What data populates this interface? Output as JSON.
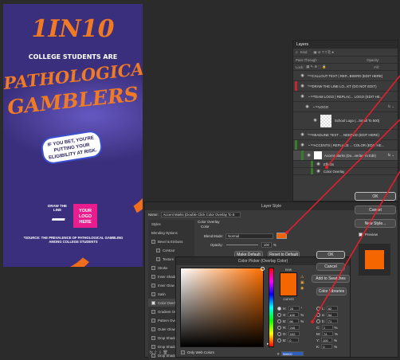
{
  "poster": {
    "headline_1": "1IN10",
    "headline_2": "COLLEGE STUDENTS ARE",
    "headline_3": "PATHOLOGICAL",
    "headline_4": "GAMBLERS",
    "bubble": "IF YOU BET, YOU'RE PUTTING YOUR ELIGIBILITY AT RISK.",
    "draw_line": "DRAW THE LINE",
    "logo_box": "YOUR LOGO HERE",
    "footnote": "*SOURCE: THE PREVALENCE OF PATHOLOGICAL GAMBLING AMONG COLLEGE STUDENTS",
    "colors": {
      "bg": "#3a2f7c",
      "orange": "#f06d1c",
      "pink": "#ea1d8f"
    }
  },
  "layers": {
    "title": "Layers",
    "search_placeholder": "Kind",
    "blend_mode": "Pass Through",
    "opacity_label": "Opacity:",
    "lock_label": "Lock:",
    "fill_label": "Fill:",
    "rows": [
      {
        "label": "CALLOUT TEXT | REP...BSERD (EDIT HERE)",
        "color": "#3b3b3b"
      },
      {
        "label": "DRAW THE LINE LO...KT (DO NOT EDIT)",
        "color": "#c1272d"
      },
      {
        "label": "TEAM LOGO | REPLAC... LOGO (EDIT HE...",
        "color": "#3b3b3b"
      },
      {
        "label": "LOGO",
        "color": "#3b3b3b"
      },
      {
        "label": "School Logo (...Small To 500)",
        "color": "#3b3b3b"
      },
      {
        "label": "HEADLINE TEXT ... NEEDED (EDIT HERE)",
        "color": "#3b3b3b"
      },
      {
        "label": "ACCENTS | REPLACE ... COLOR (EDIT HE...",
        "color": "#3b7a2a"
      },
      {
        "label": "Accent Marks (Do...verlay To Edit)",
        "color": "#3b7a2a"
      },
      {
        "label": "Effects",
        "color": "#3b7a2a"
      },
      {
        "label": "Color Overlay",
        "color": "#3b7a2a"
      }
    ]
  },
  "layer_style": {
    "title": "Layer Style",
    "name_label": "Name:",
    "name_value": "Accent Marks (Double Click Color Overlay To E",
    "sidebar": [
      "Styles",
      "Blending Options",
      "Bevel & Emboss",
      "Contour",
      "Texture",
      "Stroke",
      "Inner Shadow",
      "Inner Glow",
      "Satin",
      "Color Overlay",
      "Gradient Overlay",
      "Pattern Overlay",
      "Outer Glow",
      "Drop Shadow",
      "Drop Shadow",
      "Drop Shadow"
    ],
    "section_title": "Color Overlay",
    "section_sub": "Color",
    "blend_label": "Blend Mode:",
    "blend_value": "Normal",
    "opacity_label": "Opacity:",
    "opacity_value": "100",
    "pct": "%",
    "make_default": "Make Default",
    "reset_default": "Reset to Default",
    "ok": "OK",
    "cancel": "Cancel",
    "new_style": "New Style...",
    "preview": "Preview",
    "fx": "fx"
  },
  "picker": {
    "title": "Color Picker (Overlay Color)",
    "new_label": "new",
    "current_label": "current",
    "ok": "OK",
    "cancel": "Cancel",
    "add_swatches": "Add to Swatches",
    "libraries": "Color Libraries",
    "only_web": "Only Web Colors",
    "H": "25",
    "S": "100",
    "B": "96",
    "R": "245",
    "G": "102",
    "Bv": "0",
    "L": "62",
    "a": "54",
    "b": "71",
    "C": "0",
    "M": "74",
    "Y": "100",
    "K": "0",
    "hex_label": "#",
    "hex": "f66600",
    "deg": "°",
    "pct": "%",
    "colors": {
      "swatch": "#f66600"
    }
  }
}
